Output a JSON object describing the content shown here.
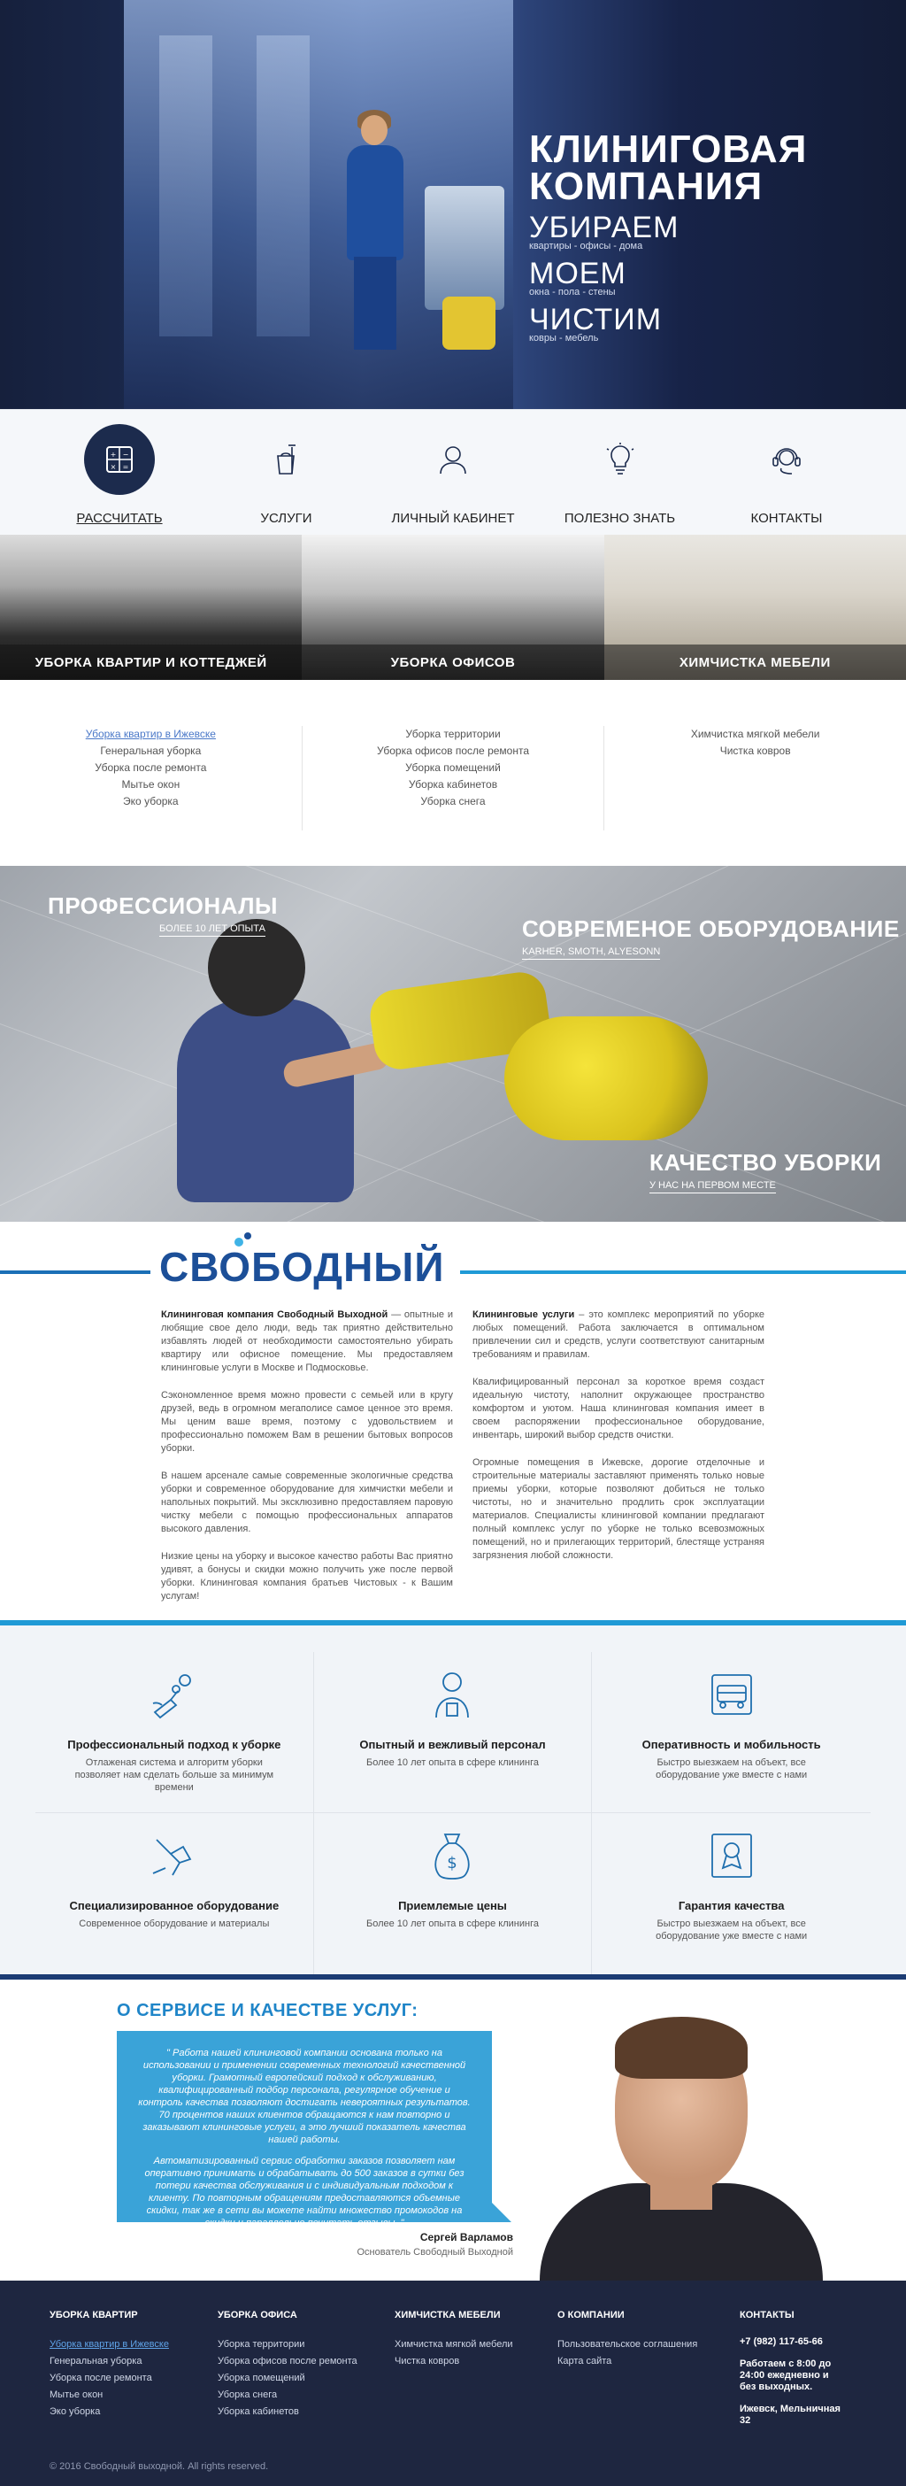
{
  "hero": {
    "title": "КЛИНИГОВАЯ КОМПАНИЯ",
    "items": [
      {
        "big": "УБИРАЕМ",
        "small": "квартиры - офисы - дома"
      },
      {
        "big": "МОЕМ",
        "small": "окна - пола - стены"
      },
      {
        "big": "ЧИСТИМ",
        "small": "ковры - мебель"
      }
    ]
  },
  "nav": {
    "items": [
      {
        "label": "РАССЧИТАТЬ",
        "icon": "calculator-icon"
      },
      {
        "label": "УСЛУГИ",
        "icon": "bucket-icon"
      },
      {
        "label": "ЛИЧНЫЙ КАБИНЕТ",
        "icon": "user-icon"
      },
      {
        "label": "ПОЛЕЗНО ЗНАТЬ",
        "icon": "lightbulb-icon"
      },
      {
        "label": "КОНТАКТЫ",
        "icon": "headset-icon"
      }
    ]
  },
  "categories": [
    {
      "label": "УБОРКА КВАРТИР И КОТТЕДЖЕЙ"
    },
    {
      "label": "УБОРКА ОФИСОВ"
    },
    {
      "label": "ХИМЧИСТКА МЕБЕЛИ"
    }
  ],
  "links": {
    "col1": [
      "Уборка квартир в Ижевске",
      "Генеральная уборка",
      "Уборка после ремонта",
      "Мытье окон",
      "Эко уборка"
    ],
    "col2": [
      "Уборка территории",
      "Уборка офисов после ремонта",
      "Уборка помещений",
      "Уборка кабинетов",
      "Уборка снега"
    ],
    "col3": [
      "Химчистка мягкой мебели",
      "Чистка ковров"
    ]
  },
  "pro": {
    "p1": {
      "title": "ПРОФЕССИОНАЛЫ",
      "sub": "БОЛЕЕ 10 ЛЕТ ОПЫТА"
    },
    "p2": {
      "title": "СОВРЕМЕНОЕ ОБОРУДОВАНИЕ",
      "sub": "KARHER, SMOTH, ALYESONN"
    },
    "p3": {
      "title": "КАЧЕСТВО УБОРКИ",
      "sub": "У НАС НА ПЕРВОМ МЕСТЕ"
    }
  },
  "brand": {
    "logo": "СВОБОДНЫЙ"
  },
  "about": {
    "c1p1_b": "Клининговая компания Свободный Выходной",
    "c1p1": " — опытные и любящие свое дело люди, ведь так приятно действительно избавлять людей от необходимости самостоятельно убирать квартиру или офисное помещение. Мы предоставляем клининговые услуги в Москве и Подмосковье.",
    "c1p2": "Сэкономленное время можно провести с семьей или в кругу друзей, ведь в огромном мегаполисе самое ценное это время. Мы ценим ваше время, поэтому с удовольствием и профессионально поможем Вам в решении бытовых вопросов уборки.",
    "c1p3": "В нашем арсенале самые современные экологичные средства уборки и современное оборудование для химчистки мебели и напольных покрытий. Мы эксклюзивно предоставляем паровую чистку мебели с помощью профессиональных аппаратов высокого давления.",
    "c1p4": "Низкие цены на уборку и высокое качество работы Вас приятно удивят, а бонусы и скидки можно получить уже после первой уборки. Клининговая компания братьев Чистовых - к Вашим услугам!",
    "c2p1_b": "Клининговые услуги",
    "c2p1": " – это комплекс мероприятий по уборке любых помещений. Работа заключается в оптимальном привлечении сил и средств, услуги соответствуют санитарным требованиям и правилам.",
    "c2p2": "Квалифицированный персонал за короткое время создаст идеальную чистоту, наполнит окружающее пространство комфортом и уютом. Наша клининговая компания имеет в своем распоряжении профессиональное оборудование, инвентарь, широкий выбор средств очистки.",
    "c2p3": "Огромные помещения в Ижевске, дорогие отделочные и строительные материалы заставляют применять только новые приемы уборки, которые позволяют добиться не только чистоты, но и значительно продлить срок эксплуатации материалов. Специалисты клининговой компании предлагают полный комплекс услуг по уборке не только всевозможных помещений, но и прилегающих территорий, блестяще устраняя загрязнения любой сложности."
  },
  "features": [
    {
      "title": "Профессиональный подход к уборке",
      "desc": "Отлаженая система и алгоритм уборки позволяет нам сделать больше за минимум времени",
      "icon": "gears-icon"
    },
    {
      "title": "Опытный и вежливый персонал",
      "desc": "Более 10 лет опыта в сфере клининга",
      "icon": "staff-icon"
    },
    {
      "title": "Оперативность и мобильность",
      "desc": "Быстро выезжаем на объект, все оборудование уже вместе с нами",
      "icon": "van-icon"
    },
    {
      "title": "Специализированное оборудование",
      "desc": "Современное оборудование и материалы",
      "icon": "equipment-icon"
    },
    {
      "title": "Приемлемые цены",
      "desc": "Более 10 лет опыта в сфере клининга",
      "icon": "money-bag-icon"
    },
    {
      "title": "Гарантия качества",
      "desc": "Быстро выезжаем на объект, все оборудование уже вместе с нами",
      "icon": "certificate-icon"
    }
  ],
  "testimonial": {
    "heading": "О СЕРВИСЕ И КАЧЕСТВЕ УСЛУГ:",
    "q1": "\" Работа нашей клининговой компании основана только на использовании и применении современных технологий качественной уборки. Грамотный европейский подход к обслуживанию, квалифицированный подбор персонала, регулярное обучение и контроль качества позволяют достигать невероятных результатов. 70 процентов наших клиентов обращаются к нам повторно и заказывают клининговые услуги, а это лучший показатель качества нашей работы.",
    "q2": "Автоматизированный сервис обработки заказов позволяет нам оперативно принимать и обрабатывать до 500 заказов в сутки без потери качества обслуживания и с индивидуальным подходом к клиенту. По повторным обращениям предоставляются объемные скидки, так же в сети вы можете найти множество промокодов на скидки и параллельно почитать отзывы. \"",
    "name": "Сергей Варламов",
    "role": "Основатель Свободный Выходной"
  },
  "footer": {
    "c1": {
      "title": "УБОРКА КВАРТИР",
      "items": [
        "Уборка квартир в Ижевске",
        "Генеральная уборка",
        "Уборка после ремонта",
        "Мытье окон",
        "Эко уборка"
      ]
    },
    "c2": {
      "title": "УБОРКА ОФИСА",
      "items": [
        "Уборка территории",
        "Уборка офисов после ремонта",
        "Уборка помещений",
        "Уборка снега",
        "Уборка кабинетов"
      ]
    },
    "c3": {
      "title": "ХИМЧИСТКА МЕБЕЛИ",
      "items": [
        "Химчистка мягкой мебели",
        "Чистка ковров"
      ]
    },
    "c4": {
      "title": "О КОМПАНИИ",
      "items": [
        "Пользовательское соглашения",
        "Карта сайта"
      ]
    },
    "c5": {
      "title": "КОНТАКТЫ",
      "phone": "+7 (982) 117-65-66",
      "hours": "Работаем с 8:00 до 24:00 ежедневно и без выходных.",
      "address": "Ижевск, Мельничная 32"
    },
    "copyright": "© 2016 Свободный выходной. All rights reserved."
  }
}
